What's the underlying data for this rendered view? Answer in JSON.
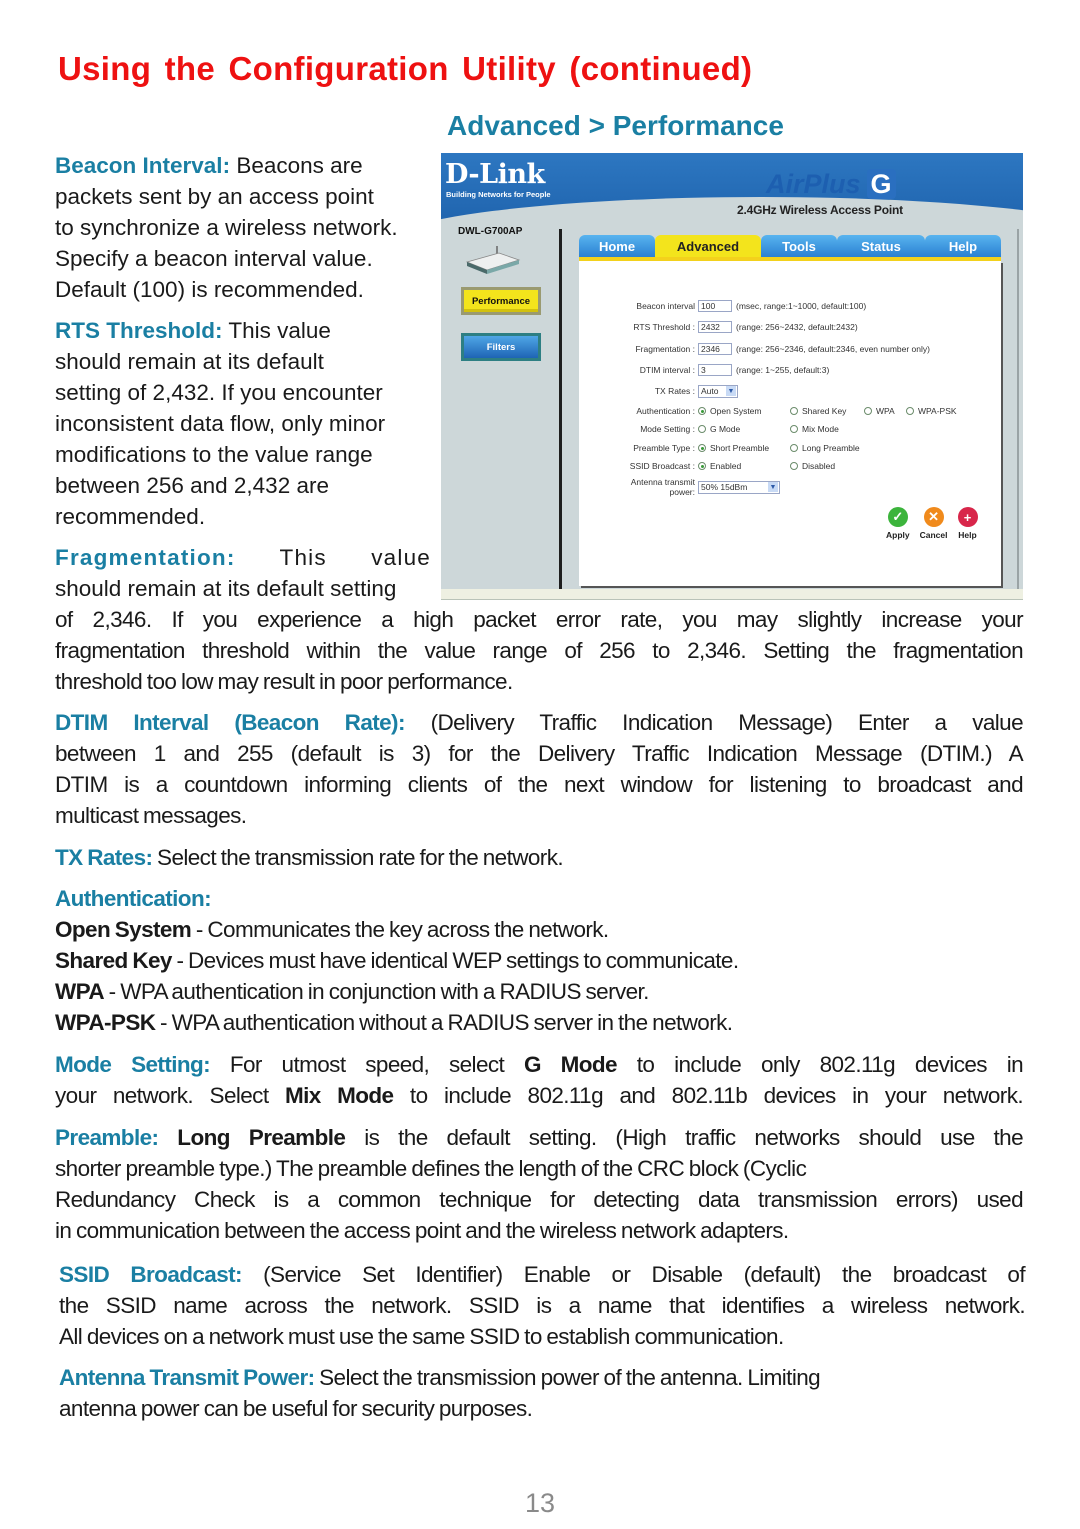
{
  "page": {
    "title": "Using the Configuration Utility (continued)",
    "subtitle": "Advanced > Performance",
    "page_number": "13"
  },
  "colors": {
    "title": "#ee1111",
    "heading_accent": "#1a7fa3",
    "body_text": "#1a1a1a",
    "page_number": "#8a8a8a"
  },
  "screenshot": {
    "brand": "D-Link",
    "tagline": "Building Networks for People",
    "product_name": "AirPlus",
    "product_letter": "G",
    "product_desc": "2.4GHz Wireless Access Point",
    "model": "DWL-G700AP",
    "device_icon": "router-icon",
    "sidebar": [
      {
        "label": "Performance",
        "active": true
      },
      {
        "label": "Filters",
        "active": false
      }
    ],
    "tabs": [
      {
        "label": "Home",
        "active": false
      },
      {
        "label": "Advanced",
        "active": true
      },
      {
        "label": "Tools",
        "active": false
      },
      {
        "label": "Status",
        "active": false
      },
      {
        "label": "Help",
        "active": false
      }
    ],
    "form": {
      "beacon_interval": {
        "label": "Beacon interval",
        "value": "100",
        "hint": "(msec, range:1~1000, default:100)"
      },
      "rts_threshold": {
        "label": "RTS Threshold :",
        "value": "2432",
        "hint": "(range: 256~2432, default:2432)"
      },
      "fragmentation": {
        "label": "Fragmentation :",
        "value": "2346",
        "hint": "(range: 256~2346, default:2346, even number only)"
      },
      "dtim_interval": {
        "label": "DTIM interval :",
        "value": "3",
        "hint": "(range: 1~255, default:3)"
      },
      "tx_rates": {
        "label": "TX Rates :",
        "selected": "Auto"
      },
      "authentication": {
        "label": "Authentication :",
        "options": [
          "Open System",
          "Shared Key",
          "WPA",
          "WPA-PSK"
        ],
        "selected": "Open System"
      },
      "mode_setting": {
        "label": "Mode Setting :",
        "options": [
          "G Mode",
          "Mix Mode"
        ],
        "selected": null
      },
      "preamble_type": {
        "label": "Preamble Type :",
        "options": [
          "Short Preamble",
          "Long Preamble"
        ],
        "selected": "Short Preamble"
      },
      "ssid_broadcast": {
        "label": "SSID Broadcast :",
        "options": [
          "Enabled",
          "Disabled"
        ],
        "selected": "Enabled"
      },
      "antenna_power": {
        "label_line1": "Antenna transmit",
        "label_line2": "power:",
        "selected": "50% 15dBm"
      }
    },
    "actions": [
      {
        "label": "Apply",
        "icon": "check-icon",
        "glyph": "✓",
        "color": "#3cb43c"
      },
      {
        "label": "Cancel",
        "icon": "cancel-icon",
        "glyph": "✕",
        "color": "#f08a1c"
      },
      {
        "label": "Help",
        "icon": "help-plus-icon",
        "glyph": "+",
        "color": "#d8264a"
      }
    ]
  },
  "sections": {
    "beacon": {
      "label": "Beacon Interval:",
      "lines": [
        " Beacons are",
        "packets sent by an access point",
        "to synchronize a wireless network.",
        "Specify a beacon interval value.",
        "Default (100) is recommended."
      ]
    },
    "rts": {
      "label": "RTS Threshold:",
      "lines": "  This value",
      "body": [
        "should remain at its default",
        "setting of 2,432. If you encounter",
        "inconsistent data flow, only minor",
        "modifications to the value range",
        "between 256 and 2,432 are",
        "recommended."
      ]
    },
    "fragmentation": {
      "label": "Fragmentation:",
      "first": " This value",
      "line2": "should remain at its default setting",
      "rest": [
        "of 2,346. If you experience a high packet error rate, you may slightly increase your",
        "fragmentation threshold within the value range of 256 to 2,346. Setting the fragmentation",
        "threshold too low may result in poor performance."
      ]
    },
    "dtim": {
      "label": "DTIM Interval (Beacon Rate)",
      "colon": ":",
      "lines": [
        " (Delivery Traffic Indication Message) Enter a value",
        "between 1 and 255  (default is 3) for the Delivery Traffic Indication Message (DTIM.) A",
        "DTIM is a countdown informing clients of the next window for listening to broadcast and",
        "multicast messages."
      ]
    },
    "tx": {
      "label": "TX Rates:",
      "text": " Select the transmission rate for the network."
    },
    "auth": {
      "label": "Authentication:",
      "items": [
        {
          "term": "Open System",
          "desc": " - Communicates the key across the network."
        },
        {
          "term": "Shared Key",
          "desc": " - Devices must have identical WEP settings to communicate."
        },
        {
          "term": "WPA",
          "desc": " - WPA authentication in conjunction with a RADIUS server."
        },
        {
          "term": "WPA-PSK",
          "desc": " - WPA authentication without a RADIUS server in the network."
        }
      ]
    },
    "mode": {
      "label": "Mode Setting:",
      "l1a": " For utmost speed, select ",
      "l1b": "G Mode",
      "l1c": " to include only 802.11g devices in",
      "l2a": "your network. Select ",
      "l2b": "Mix Mode",
      "l2c": " to include 802.11g and 802.11b devices in your network."
    },
    "preamble": {
      "label": "Preamble:",
      "bold": " Long Preamble",
      "l1": " is the default setting. (High traffic networks should use the",
      "lines": [
        "shorter preamble type.) The preamble defines the length of the CRC block (Cyclic",
        "Redundancy Check is a common technique for detecting data transmission errors) used",
        "in communication between the access point and the wireless network adapters."
      ]
    },
    "ssid": {
      "label": "SSID Broadcast:",
      "lines": [
        "  (Service Set Identifier) Enable or Disable (default) the broadcast of",
        "the SSID name across the network. SSID is a name that identifies a wireless network.",
        "All devices on a network must use the same SSID to establish communication."
      ]
    },
    "antenna": {
      "label": "Antenna Transmit Power:",
      "lines": [
        " Select the transmission power of the antenna. Limiting",
        "antenna power can be useful for security purposes."
      ]
    }
  }
}
